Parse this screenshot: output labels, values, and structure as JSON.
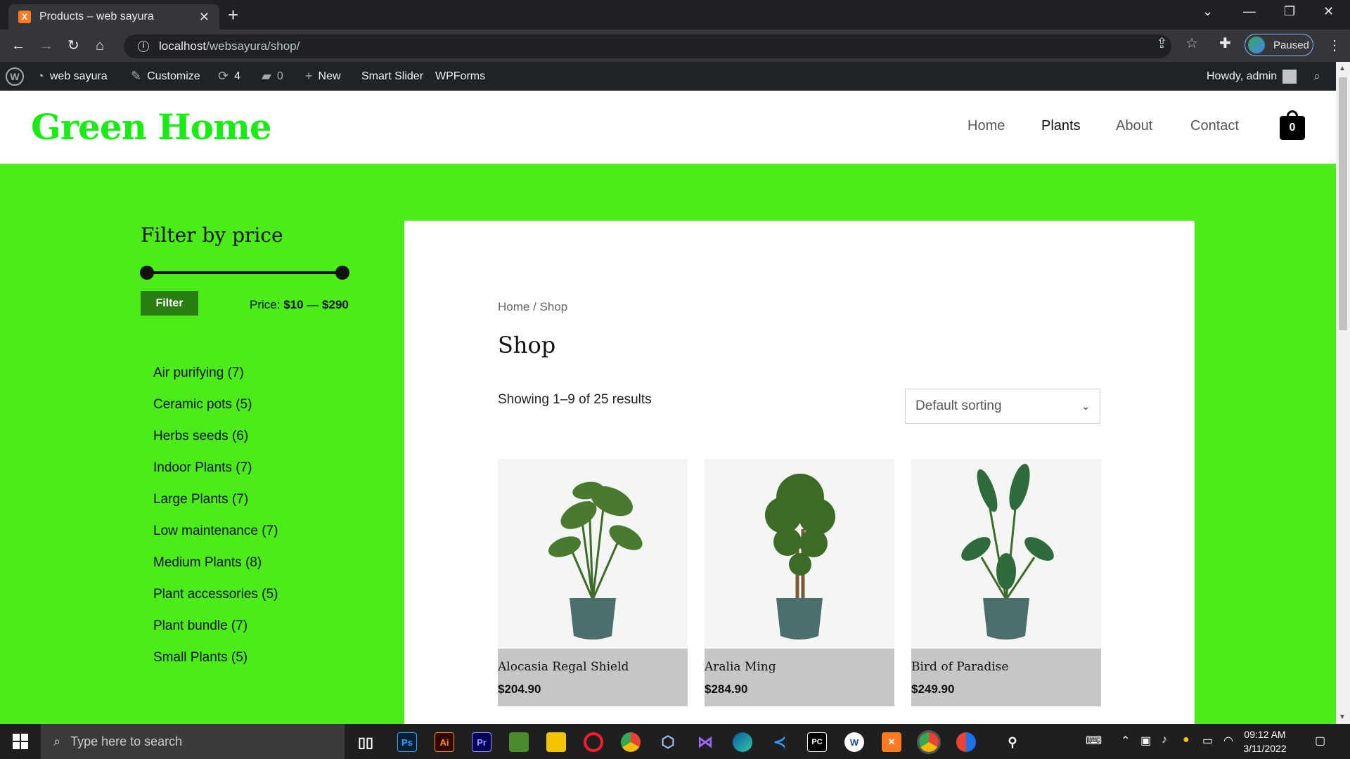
{
  "browser": {
    "tab_title": "Products – web sayura",
    "favicon_letter": "X",
    "url_host": "localhost",
    "url_path": "/websayura/shop/",
    "profile_label": "Paused"
  },
  "adminbar": {
    "site_name": "web sayura",
    "customize": "Customize",
    "updates_count": "4",
    "comments_count": "0",
    "new_label": "New",
    "smart_slider": "Smart Slider",
    "wpforms": "WPForms",
    "howdy": "Howdy, admin"
  },
  "site": {
    "logo": "Green Home",
    "nav": [
      "Home",
      "Plants",
      "About",
      "Contact"
    ],
    "cart_count": "0"
  },
  "sidebar": {
    "filter_title": "Filter by price",
    "filter_button": "Filter",
    "price_prefix": "Price:",
    "price_min": "$10",
    "price_sep": " — ",
    "price_max": "$290",
    "categories": [
      "Air purifying (7)",
      "Ceramic pots (5)",
      "Herbs seeds (6)",
      "Indoor Plants (7)",
      "Large Plants (7)",
      "Low maintenance (7)",
      "Medium Plants (8)",
      "Plant accessories (5)",
      "Plant bundle (7)",
      "Small Plants (5)"
    ]
  },
  "shop": {
    "breadcrumb_home": "Home",
    "breadcrumb_sep": " / ",
    "breadcrumb_current": "Shop",
    "title": "Shop",
    "results": "Showing 1–9 of 25 results",
    "sorting": "Default sorting",
    "products": [
      {
        "name": "Alocasia Regal Shield",
        "price": "$204.90"
      },
      {
        "name": "Aralia Ming",
        "price": "$284.90"
      },
      {
        "name": "Bird of Paradise",
        "price": "$249.90"
      }
    ]
  },
  "taskbar": {
    "search_placeholder": "Type here to search",
    "apps": [
      "Ps",
      "Ai",
      "Pr",
      "PC",
      "W"
    ],
    "time": "09:12 AM",
    "date": "3/11/2022"
  },
  "colors": {
    "page_green": "#4cec1a",
    "logo_green": "#19ec14",
    "filter_button": "#2a7d0f",
    "adminbar": "#1d2327"
  }
}
